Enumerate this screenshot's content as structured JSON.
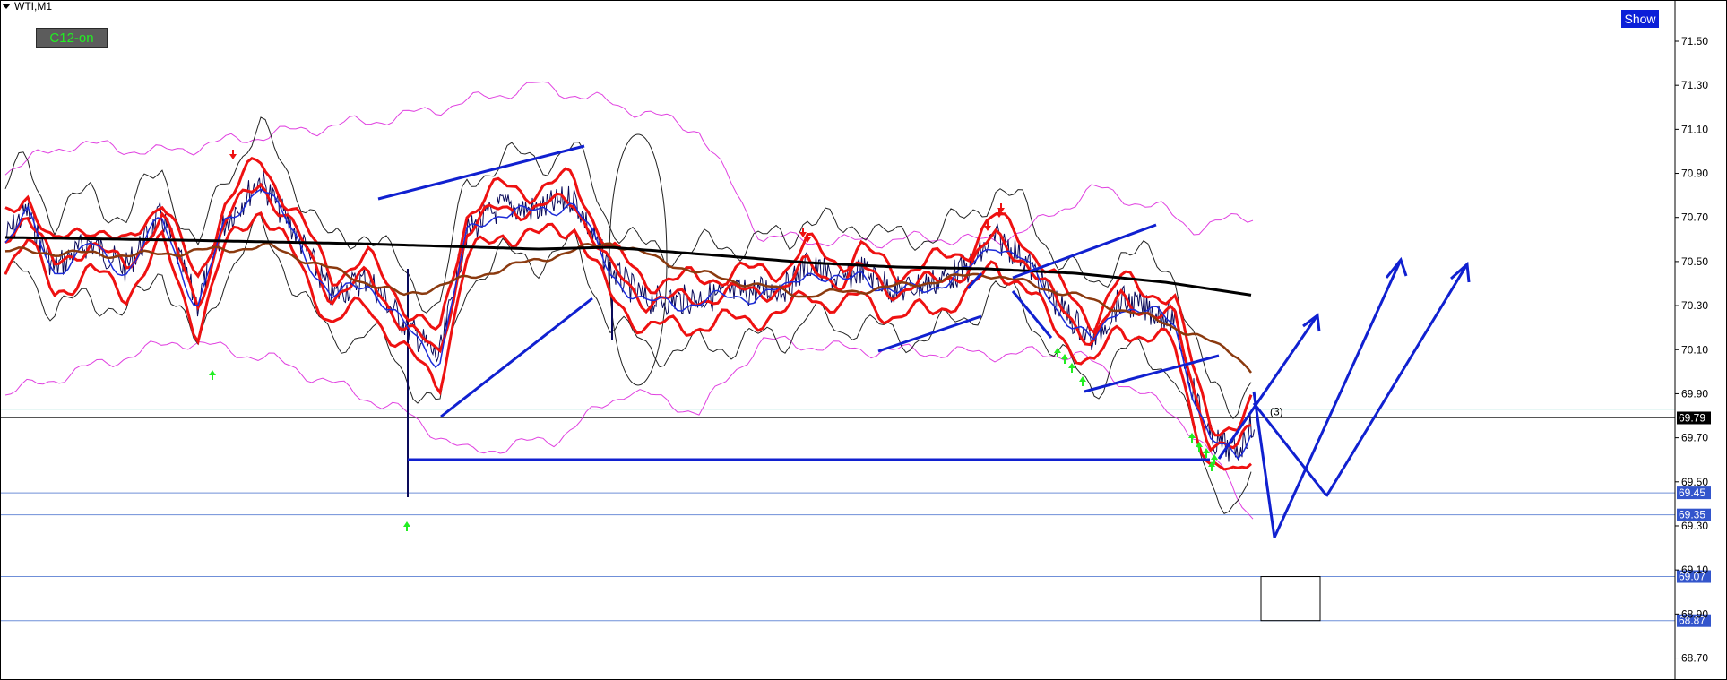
{
  "header": {
    "symbol_label": "WTI,M1"
  },
  "controls": {
    "c12_label": "C12-on",
    "show_label": "Show"
  },
  "colors": {
    "bars": "#0a0a5a",
    "ma_red": "#ee1111",
    "ma_blue": "#1c2bd8",
    "ma_brown": "#8b3a0f",
    "ma_black": "#000000",
    "envelope": "#e040e0",
    "trendline": "#1020d0",
    "up_arrow": "#22ee22",
    "down_arrow": "#ee1111",
    "level_line": "#6f8fd8",
    "price_tag": "#3355cc"
  },
  "chart_data": {
    "type": "line",
    "title": "WTI,M1",
    "ylim": [
      68.6,
      71.75
    ],
    "y_ticks": [
      "71.50",
      "71.30",
      "71.10",
      "70.90",
      "70.70",
      "70.50",
      "70.30",
      "70.10",
      "69.90",
      "69.70",
      "69.50",
      "69.30",
      "69.10",
      "68.90",
      "68.70"
    ],
    "current_price": "69.79",
    "horizontal_levels": [
      "69.45",
      "69.35",
      "69.07",
      "68.87"
    ],
    "annotation": "(3)",
    "legend": "none",
    "grid": false
  }
}
